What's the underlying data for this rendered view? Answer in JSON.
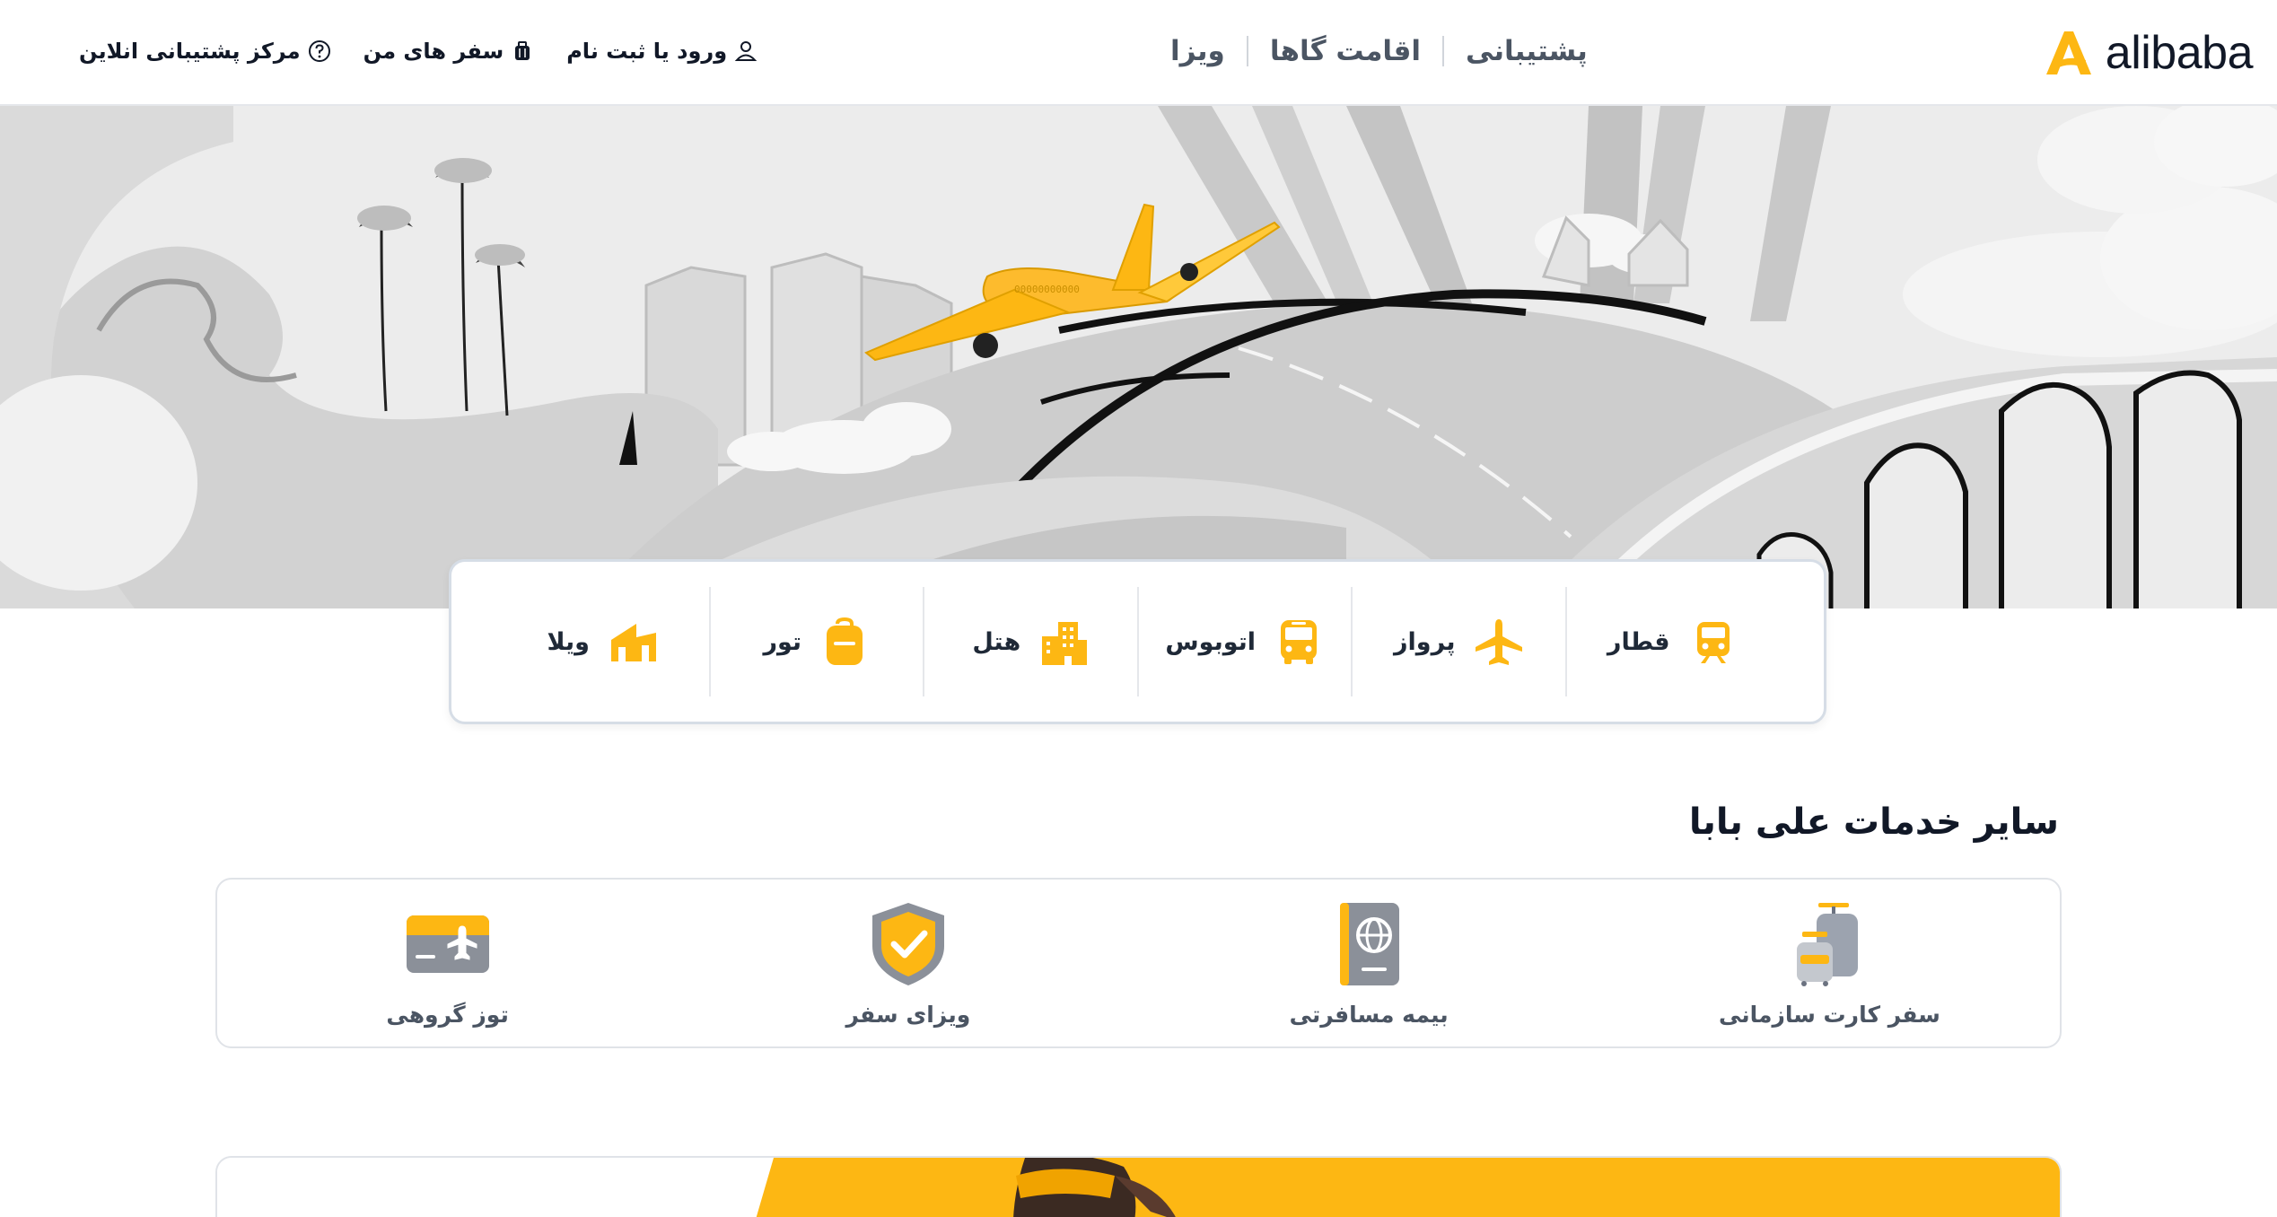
{
  "header": {
    "logo_text": "alibaba",
    "nav": [
      {
        "label": "پشتیبانی"
      },
      {
        "label": "اقامت گاها"
      },
      {
        "label": "ویزا"
      }
    ],
    "user_links": {
      "login": "ورود یا ثبت نام",
      "my_trips": "سفر های من",
      "support_center": "مرکز پشتیبانی انلاین"
    }
  },
  "hero": {
    "plane_marking": "00000000000"
  },
  "service_tabs": [
    {
      "label": "قطار",
      "icon": "train-icon"
    },
    {
      "label": "پرواز",
      "icon": "plane-icon"
    },
    {
      "label": "اتوبوس",
      "icon": "bus-icon"
    },
    {
      "label": "هتل",
      "icon": "hotel-icon"
    },
    {
      "label": "تور",
      "icon": "tour-bag-icon"
    },
    {
      "label": "ویلا",
      "icon": "villa-icon"
    }
  ],
  "other_services": {
    "title": "سایر خدمات علی بابا",
    "items": [
      {
        "label": "سفر کارت سازمانی",
        "icon": "luggage-icon"
      },
      {
        "label": "بیمه مسافرتی",
        "icon": "passport-icon"
      },
      {
        "label": "ویزای سفر",
        "icon": "shield-check-icon"
      },
      {
        "label": "توز گروهی",
        "icon": "ticket-plane-icon"
      }
    ]
  },
  "colors": {
    "brand_yellow": "#fdb713",
    "text_dark": "#111827",
    "text_muted": "#4b5563",
    "border": "#e0e3e8"
  }
}
